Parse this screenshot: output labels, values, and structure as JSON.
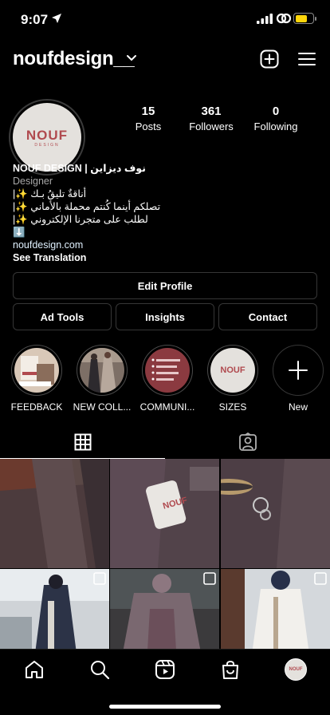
{
  "status_bar": {
    "time": "9:07",
    "battery_level": 0.68,
    "battery_color": "#ffd60a"
  },
  "header": {
    "username": "noufdesign__",
    "icons": [
      "chevron-down-icon",
      "new-post-icon",
      "menu-icon"
    ]
  },
  "profile": {
    "avatar_logo": "NOUF",
    "avatar_logo_sub": "DESIGN",
    "stats": [
      {
        "number": "15",
        "label": "Posts"
      },
      {
        "number": "361",
        "label": "Followers"
      },
      {
        "number": "0",
        "label": "Following"
      }
    ],
    "bio": {
      "name": "NOUF DESIGN | نوف ديزاين",
      "category": "Designer",
      "line1": "أناقةٌ تليقُ بـك ✨|",
      "line2": "تصلكم أينما كُنتم محملة بالأماني ✨|",
      "line3": "لطلب على متجرنا الإلكتروني ✨|",
      "line4": "⬇️",
      "website": "noufdesign.com",
      "see_translation": "See Translation"
    }
  },
  "buttons": {
    "edit_profile": "Edit Profile",
    "ad_tools": "Ad Tools",
    "insights": "Insights",
    "contact": "Contact"
  },
  "highlights": [
    {
      "label": "FEEDBACK"
    },
    {
      "label": "NEW COLL..."
    },
    {
      "label": "COMMUNI..."
    },
    {
      "label": "SIZES"
    },
    {
      "label": "New"
    }
  ],
  "tabs": [
    "grid-icon",
    "tagged-icon"
  ],
  "nav": [
    "home-icon",
    "search-icon",
    "reels-icon",
    "shop-icon",
    "profile-avatar"
  ],
  "colors": {
    "background": "#000000",
    "border": "#363636",
    "brand": "#b04a4f",
    "muted_text": "#a8a8a8"
  }
}
